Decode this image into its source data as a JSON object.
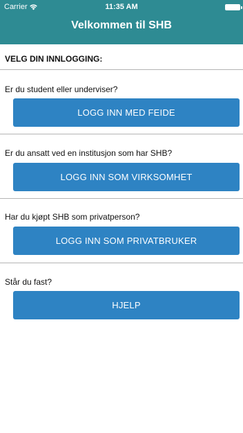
{
  "status_bar": {
    "carrier": "Carrier",
    "time": "11:35 AM",
    "icons": [
      "wifi-icon",
      "battery-icon"
    ]
  },
  "nav": {
    "title": "Velkommen til SHB"
  },
  "heading": "VELG DIN INNLOGGING:",
  "sections": [
    {
      "question": "Er du student eller underviser?",
      "button_label": "LOGG INN MED FEIDE"
    },
    {
      "question": "Er du ansatt ved en institusjon som har SHB?",
      "button_label": "LOGG INN SOM VIRKSOMHET"
    },
    {
      "question": "Har du kjøpt SHB som privatperson?",
      "button_label": "LOGG INN SOM PRIVATBRUKER"
    },
    {
      "question": "Står du fast?",
      "button_label": "HJELP"
    }
  ],
  "colors": {
    "header_background": "#2e8b93",
    "button_background": "#2e83c3",
    "divider": "#b4b4b4"
  }
}
